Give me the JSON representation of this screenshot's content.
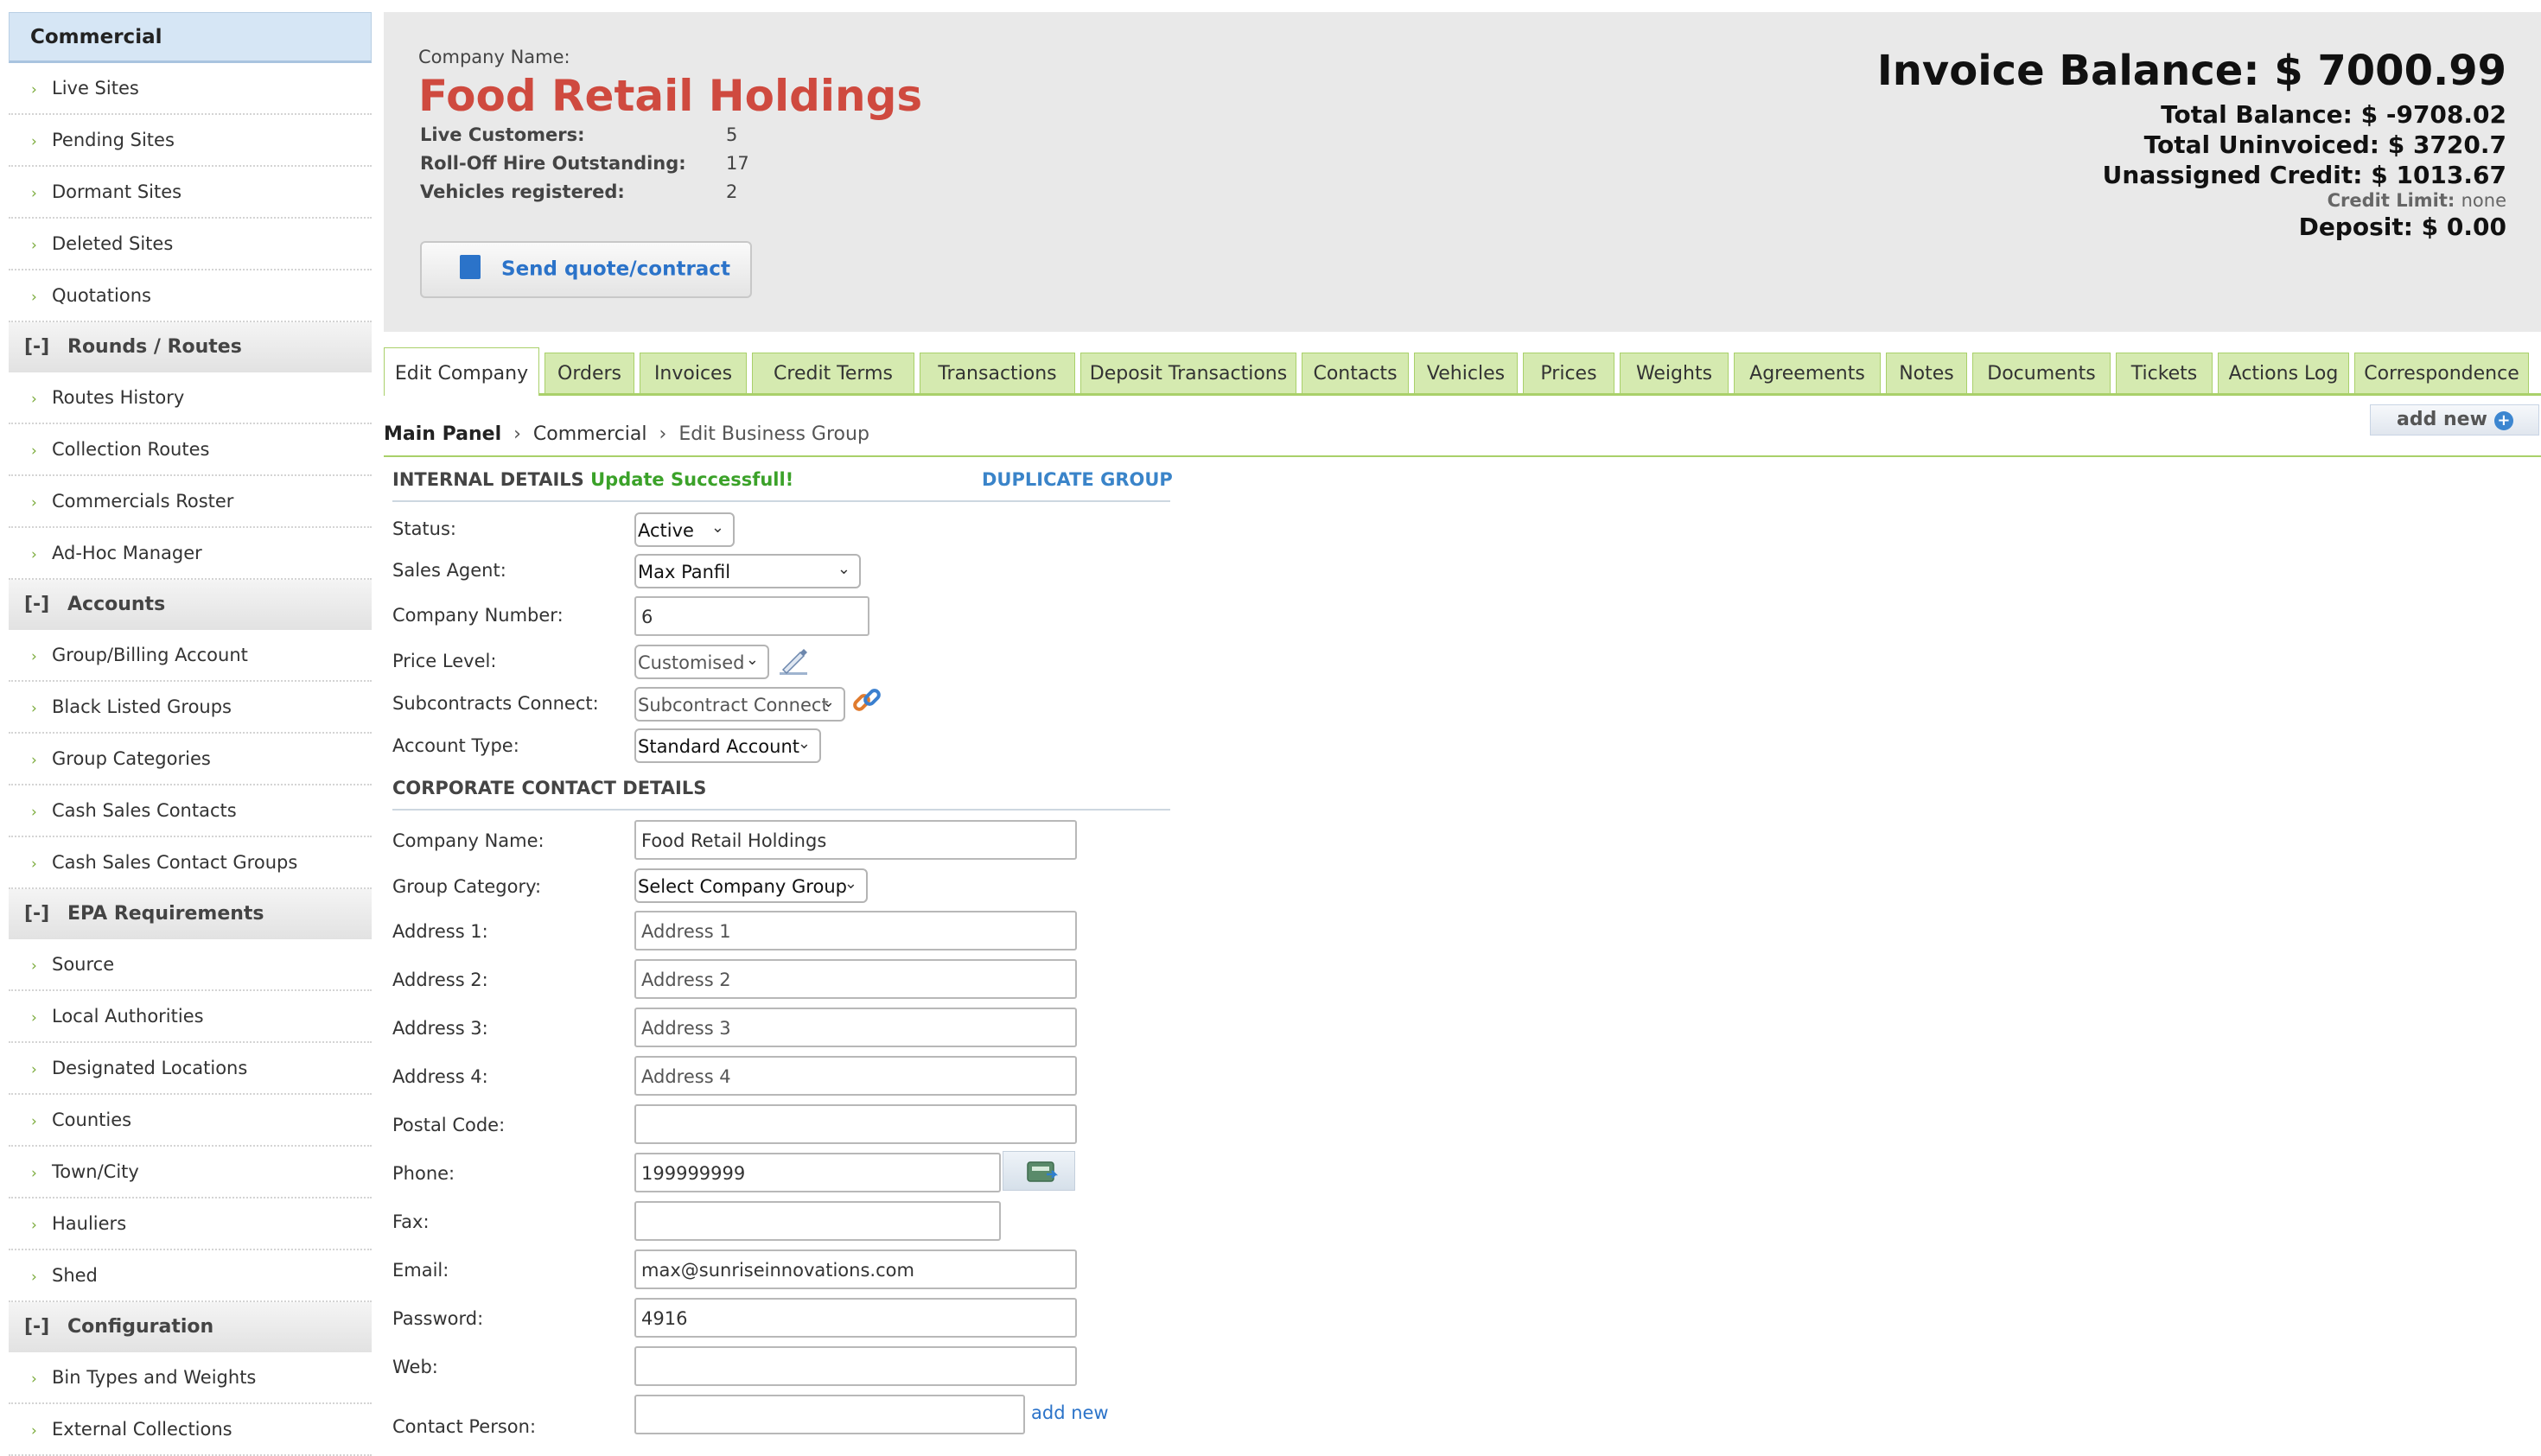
{
  "sidebar": {
    "header": "Commercial",
    "groups": [
      {
        "items": [
          "Live Sites",
          "Pending Sites",
          "Dormant Sites",
          "Deleted Sites",
          "Quotations"
        ]
      },
      {
        "toggle": "[-]",
        "title": "Rounds / Routes",
        "items": [
          "Routes History",
          "Collection Routes",
          "Commercials Roster",
          "Ad-Hoc Manager"
        ]
      },
      {
        "toggle": "[-]",
        "title": "Accounts",
        "items": [
          "Group/Billing Account",
          "Black Listed Groups",
          "Group Categories",
          "Cash Sales Contacts",
          "Cash Sales Contact Groups"
        ]
      },
      {
        "toggle": "[-]",
        "title": "EPA Requirements",
        "items": [
          "Source",
          "Local Authorities",
          "Designated Locations",
          "Counties",
          "Town/City",
          "Hauliers",
          "Shed"
        ]
      },
      {
        "toggle": "[-]",
        "title": "Configuration",
        "items": [
          "Bin Types and Weights",
          "External Collections"
        ]
      }
    ]
  },
  "header": {
    "company_label": "Company Name:",
    "company_name": "Food Retail Holdings",
    "stats": [
      {
        "label": "Live Customers:",
        "value": "5"
      },
      {
        "label": "Roll-Off Hire Outstanding:",
        "value": "17"
      },
      {
        "label": "Vehicles registered:",
        "value": "2"
      }
    ],
    "quote_button": "Send quote/contract",
    "invoice_balance": "Invoice Balance: $ 7000.99",
    "total_balance": "Total Balance: $ -9708.02",
    "total_uninvoiced": "Total Uninvoiced: $ 3720.7",
    "unassigned_credit": "Unassigned Credit: $ 1013.67",
    "credit_limit_label": "Credit Limit:",
    "credit_limit_value": "none",
    "deposit": "Deposit: $ 0.00"
  },
  "tabs": [
    "Edit Company",
    "Orders",
    "Invoices",
    "Credit Terms",
    "Transactions",
    "Deposit Transactions",
    "Contacts",
    "Vehicles",
    "Prices",
    "Weights",
    "Agreements",
    "Notes",
    "Documents",
    "Tickets",
    "Actions Log",
    "Correspondence"
  ],
  "breadcrumb": {
    "root": "Main Panel",
    "mid": "Commercial",
    "current": "Edit Business Group",
    "sep": "›"
  },
  "add_new_top": "add new",
  "internal": {
    "title": "INTERNAL DETAILS",
    "success": "Update Successfull!",
    "duplicate": "DUPLICATE GROUP",
    "status_label": "Status:",
    "status_value": "Active",
    "agent_label": "Sales Agent:",
    "agent_value": "Max Panfil",
    "number_label": "Company Number:",
    "number_value": "6",
    "price_label": "Price Level:",
    "price_value": "Customised",
    "subcontract_label": "Subcontracts Connect:",
    "subcontract_value": "Subcontract Connect",
    "account_label": "Account Type:",
    "account_value": "Standard Account"
  },
  "corporate": {
    "title": "CORPORATE CONTACT DETAILS",
    "company_label": "Company Name:",
    "company_value": "Food Retail Holdings",
    "category_label": "Group Category:",
    "category_value": "Select Company Group",
    "addr1_label": "Address 1:",
    "addr1_placeholder": "Address 1",
    "addr2_label": "Address 2:",
    "addr2_placeholder": "Address 2",
    "addr3_label": "Address 3:",
    "addr3_placeholder": "Address 3",
    "addr4_label": "Address 4:",
    "addr4_placeholder": "Address 4",
    "postal_label": "Postal Code:",
    "postal_value": "",
    "phone_label": "Phone:",
    "phone_value": "199999999",
    "fax_label": "Fax:",
    "fax_value": "",
    "email_label": "Email:",
    "email_value": "max@sunriseinnovations.com",
    "password_label": "Password:",
    "password_value": "4916",
    "web_label": "Web:",
    "web_value": "",
    "contact_label": "Contact Person:",
    "contact_value": "",
    "add_new": "add new"
  },
  "colors": {
    "accent_green": "#a9d06a",
    "brand_red": "#cf4a3f",
    "link_blue": "#2b73c9",
    "success_green": "#3ba229"
  }
}
